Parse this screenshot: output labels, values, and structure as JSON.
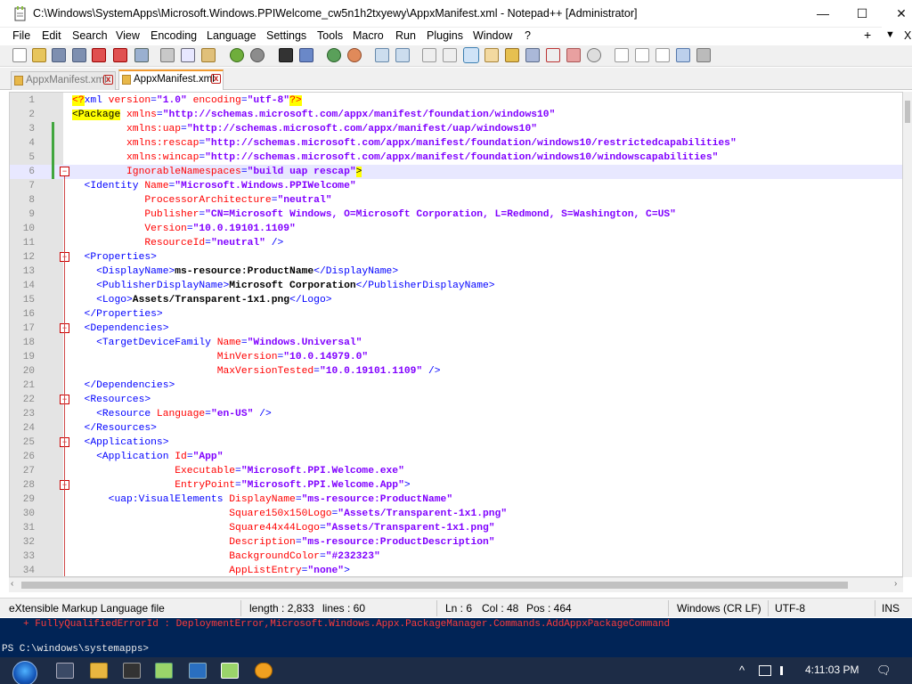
{
  "window": {
    "title": "C:\\Windows\\SystemApps\\Microsoft.Windows.PPIWelcome_cw5n1h2txyewy\\AppxManifest.xml - Notepad++ [Administrator]",
    "minimize_glyph": "—",
    "maximize_glyph": "☐",
    "close_glyph": "✕"
  },
  "menu": {
    "items": [
      "File",
      "Edit",
      "Search",
      "View",
      "Encoding",
      "Language",
      "Settings",
      "Tools",
      "Macro",
      "Run",
      "Plugins",
      "Window",
      "?"
    ],
    "right_plus": "+",
    "right_down": "▼",
    "right_close": "X"
  },
  "tabs": [
    {
      "label": "AppxManifest.xml",
      "active": false
    },
    {
      "label": "AppxManifest.xml",
      "active": true
    }
  ],
  "tab_close_glyph": "x",
  "editor": {
    "lines": [
      {
        "n": "1",
        "parts": [
          [
            "pi",
            "<?"
          ],
          [
            "tg",
            "xml"
          ],
          [
            "at",
            " version"
          ],
          [
            "tg",
            "="
          ],
          [
            "av",
            "\"1.0\""
          ],
          [
            "at",
            " encoding"
          ],
          [
            "tg",
            "="
          ],
          [
            "av",
            "\"utf-8\""
          ],
          [
            "pi",
            "?>"
          ]
        ]
      },
      {
        "n": "2",
        "parts": [
          [
            "hl",
            "<Package"
          ],
          [
            "at",
            " xmlns"
          ],
          [
            "tg",
            "="
          ],
          [
            "av",
            "\"http://schemas.microsoft.com/appx/manifest/foundation/windows10\""
          ]
        ]
      },
      {
        "n": "3",
        "parts": [
          [
            "at",
            "         xmlns:uap"
          ],
          [
            "tg",
            "="
          ],
          [
            "av",
            "\"http://schemas.microsoft.com/appx/manifest/uap/windows10\""
          ]
        ]
      },
      {
        "n": "4",
        "parts": [
          [
            "at",
            "         xmlns:rescap"
          ],
          [
            "tg",
            "="
          ],
          [
            "av",
            "\"http://schemas.microsoft.com/appx/manifest/foundation/windows10/restrictedcapabilities\""
          ]
        ]
      },
      {
        "n": "5",
        "parts": [
          [
            "at",
            "         xmlns:wincap"
          ],
          [
            "tg",
            "="
          ],
          [
            "av",
            "\"http://schemas.microsoft.com/appx/manifest/foundation/windows10/windowscapabilities\""
          ]
        ]
      },
      {
        "n": "6",
        "parts": [
          [
            "at",
            "         IgnorableNamespaces"
          ],
          [
            "tg",
            "="
          ],
          [
            "av",
            "\"build uap rescap\""
          ],
          [
            "hl",
            ">"
          ]
        ]
      },
      {
        "n": "7",
        "parts": [
          [
            "tg",
            "  <Identity"
          ],
          [
            "at",
            " Name"
          ],
          [
            "tg",
            "="
          ],
          [
            "av",
            "\"Microsoft.Windows.PPIWelcome\""
          ]
        ]
      },
      {
        "n": "8",
        "parts": [
          [
            "at",
            "            ProcessorArchitecture"
          ],
          [
            "tg",
            "="
          ],
          [
            "av",
            "\"neutral\""
          ]
        ]
      },
      {
        "n": "9",
        "parts": [
          [
            "at",
            "            Publisher"
          ],
          [
            "tg",
            "="
          ],
          [
            "av",
            "\"CN=Microsoft Windows, O=Microsoft Corporation, L=Redmond, S=Washington, C=US\""
          ]
        ]
      },
      {
        "n": "10",
        "parts": [
          [
            "at",
            "            Version"
          ],
          [
            "tg",
            "="
          ],
          [
            "av",
            "\"10.0.19101.1109\""
          ]
        ]
      },
      {
        "n": "11",
        "parts": [
          [
            "at",
            "            ResourceId"
          ],
          [
            "tg",
            "="
          ],
          [
            "av",
            "\"neutral\""
          ],
          [
            "tg",
            " />"
          ]
        ]
      },
      {
        "n": "12",
        "parts": [
          [
            "tg",
            "  <Properties>"
          ]
        ]
      },
      {
        "n": "13",
        "parts": [
          [
            "tg",
            "    <DisplayName>"
          ],
          [
            "txt",
            "ms-resource:ProductName"
          ],
          [
            "tg",
            "</DisplayName>"
          ]
        ]
      },
      {
        "n": "14",
        "parts": [
          [
            "tg",
            "    <PublisherDisplayName>"
          ],
          [
            "txt",
            "Microsoft Corporation"
          ],
          [
            "tg",
            "</PublisherDisplayName>"
          ]
        ]
      },
      {
        "n": "15",
        "parts": [
          [
            "tg",
            "    <Logo>"
          ],
          [
            "txt",
            "Assets/Transparent-1x1.png"
          ],
          [
            "tg",
            "</Logo>"
          ]
        ]
      },
      {
        "n": "16",
        "parts": [
          [
            "tg",
            "  </Properties>"
          ]
        ]
      },
      {
        "n": "17",
        "parts": [
          [
            "tg",
            "  <Dependencies>"
          ]
        ]
      },
      {
        "n": "18",
        "parts": [
          [
            "tg",
            "    <TargetDeviceFamily"
          ],
          [
            "at",
            " Name"
          ],
          [
            "tg",
            "="
          ],
          [
            "av",
            "\"Windows.Universal\""
          ]
        ]
      },
      {
        "n": "19",
        "parts": [
          [
            "at",
            "                        MinVersion"
          ],
          [
            "tg",
            "="
          ],
          [
            "av",
            "\"10.0.14979.0\""
          ]
        ]
      },
      {
        "n": "20",
        "parts": [
          [
            "at",
            "                        MaxVersionTested"
          ],
          [
            "tg",
            "="
          ],
          [
            "av",
            "\"10.0.19101.1109\""
          ],
          [
            "tg",
            " />"
          ]
        ]
      },
      {
        "n": "21",
        "parts": [
          [
            "tg",
            "  </Dependencies>"
          ]
        ]
      },
      {
        "n": "22",
        "parts": [
          [
            "tg",
            "  <Resources>"
          ]
        ]
      },
      {
        "n": "23",
        "parts": [
          [
            "tg",
            "    <Resource"
          ],
          [
            "at",
            " Language"
          ],
          [
            "tg",
            "="
          ],
          [
            "av",
            "\"en-US\""
          ],
          [
            "tg",
            " />"
          ]
        ]
      },
      {
        "n": "24",
        "parts": [
          [
            "tg",
            "  </Resources>"
          ]
        ]
      },
      {
        "n": "25",
        "parts": [
          [
            "tg",
            "  <Applications>"
          ]
        ]
      },
      {
        "n": "26",
        "parts": [
          [
            "tg",
            "    <Application"
          ],
          [
            "at",
            " Id"
          ],
          [
            "tg",
            "="
          ],
          [
            "av",
            "\"App\""
          ]
        ]
      },
      {
        "n": "27",
        "parts": [
          [
            "at",
            "                 Executable"
          ],
          [
            "tg",
            "="
          ],
          [
            "av",
            "\"Microsoft.PPI.Welcome.exe\""
          ]
        ]
      },
      {
        "n": "28",
        "parts": [
          [
            "at",
            "                 EntryPoint"
          ],
          [
            "tg",
            "="
          ],
          [
            "av",
            "\"Microsoft.PPI.Welcome.App\""
          ],
          [
            "tg",
            ">"
          ]
        ]
      },
      {
        "n": "29",
        "parts": [
          [
            "tg",
            "      <uap:VisualElements"
          ],
          [
            "at",
            " DisplayName"
          ],
          [
            "tg",
            "="
          ],
          [
            "av",
            "\"ms-resource:ProductName\""
          ]
        ]
      },
      {
        "n": "30",
        "parts": [
          [
            "at",
            "                          Square150x150Logo"
          ],
          [
            "tg",
            "="
          ],
          [
            "av",
            "\"Assets/Transparent-1x1.png\""
          ]
        ]
      },
      {
        "n": "31",
        "parts": [
          [
            "at",
            "                          Square44x44Logo"
          ],
          [
            "tg",
            "="
          ],
          [
            "av",
            "\"Assets/Transparent-1x1.png\""
          ]
        ]
      },
      {
        "n": "32",
        "parts": [
          [
            "at",
            "                          Description"
          ],
          [
            "tg",
            "="
          ],
          [
            "av",
            "\"ms-resource:ProductDescription\""
          ]
        ]
      },
      {
        "n": "33",
        "parts": [
          [
            "at",
            "                          BackgroundColor"
          ],
          [
            "tg",
            "="
          ],
          [
            "av",
            "\"#232323\""
          ]
        ]
      },
      {
        "n": "34",
        "parts": [
          [
            "at",
            "                          AppListEntry"
          ],
          [
            "tg",
            "="
          ],
          [
            "av",
            "\"none\""
          ],
          [
            "tg",
            ">"
          ]
        ]
      }
    ],
    "current_line": "6",
    "fold_lines": [
      "6",
      "12",
      "17",
      "22",
      "25",
      "28"
    ]
  },
  "status": {
    "file_type": "eXtensible Markup Language file",
    "length": "length : 2,833",
    "lines": "lines : 60",
    "ln": "Ln : 6",
    "col": "Col : 48",
    "pos": "Pos : 464",
    "eol": "Windows (CR LF)",
    "encoding": "UTF-8",
    "mode": "INS"
  },
  "console": {
    "error_line": "+ FullyQualifiedErrorId : DeploymentError,Microsoft.Windows.Appx.PackageManager.Commands.AddAppxPackageCommand",
    "prompt": "PS C:\\windows\\systemapps>"
  },
  "taskbar": {
    "clock": "4:11:03 PM",
    "tray": {
      "chevron": "^",
      "notif": "🗨"
    }
  },
  "colors": {
    "tag": "#0000ff",
    "attr": "#ff0000",
    "value": "#8000ff",
    "console_bg": "#012456",
    "taskbar": "#1d2c46"
  }
}
